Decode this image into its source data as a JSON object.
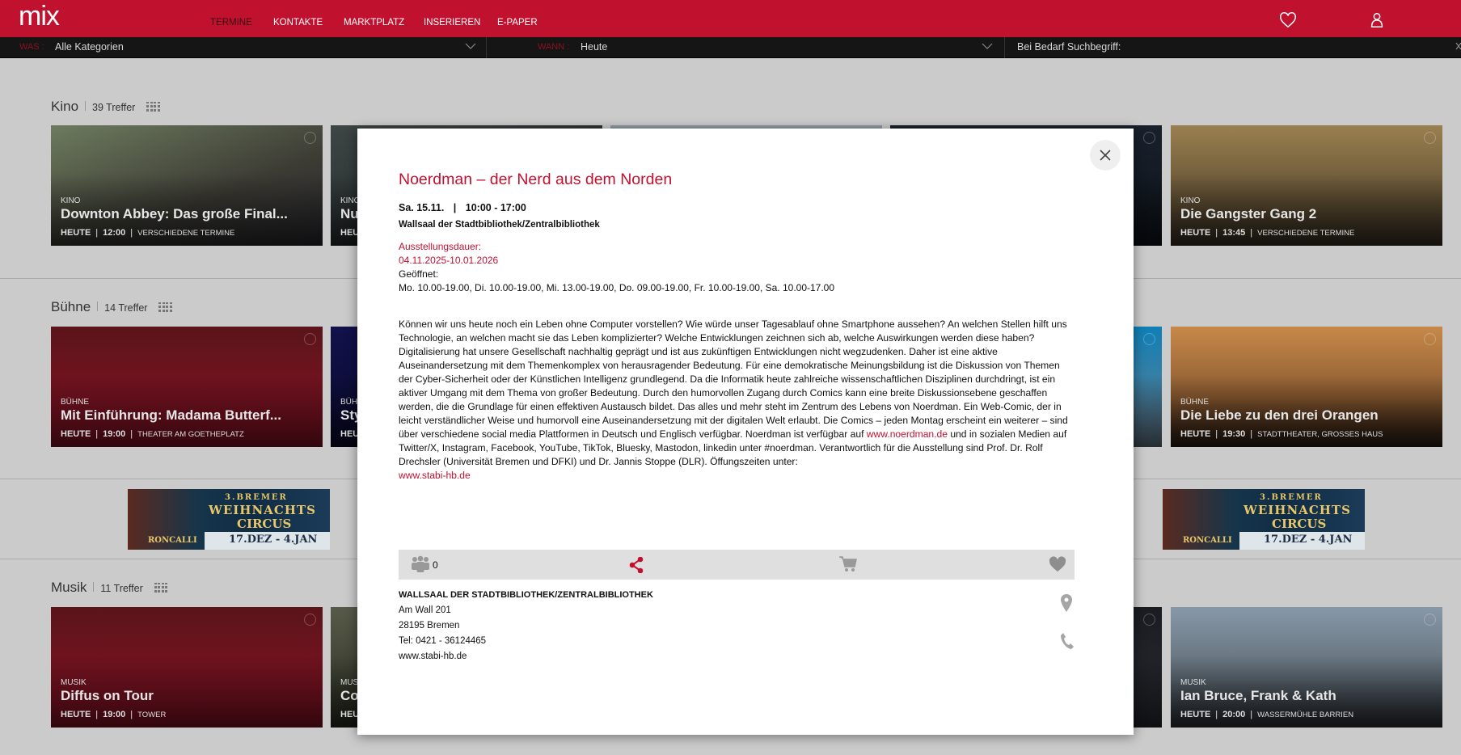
{
  "header": {
    "logo": "mix",
    "nav": [
      "TERMINE",
      "KONTAKTE",
      "MARKTPLATZ",
      "INSERIEREN",
      "E-PAPER"
    ],
    "active_nav": "TERMINE",
    "brand_color": "#c0112f"
  },
  "filter": {
    "was_label": "WAS :",
    "was_value": "Alle Kategorien",
    "wann_label": "WANN :",
    "wann_value": "Heute",
    "search_placeholder": "Bei Bedarf Suchbegriff:"
  },
  "sections": [
    {
      "title": "Kino",
      "count": "39 Treffer",
      "cards": [
        {
          "cat": "KINO",
          "title": "Downton Abbey: Das große Final...",
          "day": "HEUTE",
          "time": "12:00",
          "venue": "VERSCHIEDENE TERMINE"
        },
        {
          "cat": "KINO",
          "title": "Nu",
          "day": "HEUT"
        },
        {},
        {},
        {
          "cat": "KINO",
          "title": "Die Gangster Gang 2",
          "day": "HEUTE",
          "time": "13:45",
          "venue": "VERSCHIEDENE TERMINE"
        }
      ]
    },
    {
      "title": "Bühne",
      "count": "14 Treffer",
      "cards": [
        {
          "cat": "BÜHNE",
          "title": "Mit Einführung: Madama Butterf...",
          "day": "HEUTE",
          "time": "19:00",
          "venue": "THEATER AM GOETHEPLATZ"
        },
        {
          "cat": "BÜHN",
          "title": "Sty",
          "day": "HEU"
        },
        {},
        {},
        {
          "cat": "BÜHNE",
          "title": "Die Liebe zu den drei Orangen",
          "day": "HEUTE",
          "time": "19:30",
          "venue": "STADTTHEATER, GROSSES HAUS"
        }
      ]
    },
    {
      "title": "Musik",
      "count": "11 Treffer",
      "cards": [
        {
          "cat": "MUSIK",
          "title": "Diffus on Tour",
          "day": "HEUTE",
          "time": "19:00",
          "venue": "TOWER"
        },
        {
          "cat": "MUS",
          "title": "Co",
          "day": "HEU"
        },
        {},
        {},
        {
          "cat": "MUSIK",
          "title": "Ian Bruce, Frank & Kath",
          "day": "HEUTE",
          "time": "20:00",
          "venue": "WASSERMÜHLE BARRIEN"
        }
      ]
    }
  ],
  "banner": {
    "line1": "3.BREMER",
    "line2": "WEIHNACHTS",
    "line3": "CIRCUS",
    "dates": "17.DEZ - 4.JAN",
    "brand": "RONCALLI"
  },
  "modal": {
    "title": "Noerdman – der Nerd aus dem Norden",
    "date": "Sa. 15.11.",
    "time": "10:00 - 17:00",
    "venue": "Wallsaal der Stadtbibliothek/Zentralbibliothek",
    "duration_label": "Ausstellungsdauer:",
    "duration": "04.11.2025-10.01.2026",
    "open_label": "Geöffnet:",
    "hours": "Mo. 10.00-19.00, Di. 10.00-19.00, Mi. 13.00-19.00, Do. 09.00-19.00, Fr. 10.00-19.00, Sa. 10.00-17.00",
    "desc_1": "Können wir uns heute noch ein Leben ohne Computer vorstellen? Wie würde unser Tagesablauf ohne Smartphone aussehen? An welchen Stellen hilft uns Technologie, an welchen macht sie das Leben komplizierter? Welche Entwicklungen zeichnen sich ab, welche Auswirkungen werden diese haben? Digitalisierung hat unsere Gesellschaft nachhaltig geprägt und ist aus zukünftigen Entwicklungen nicht wegzudenken. Daher ist eine aktive Auseinandersetzung mit dem Themenkomplex von herausragender Bedeutung. Für eine demokratische Meinungsbildung ist die Diskussion von Themen der Cyber-Sicherheit oder der Künstlichen Intelligenz grundlegend. Da die Informatik heute zahlreiche wissenschaftlichen Disziplinen durchdringt, ist ein aktiver Umgang mit dem Thema von großer Bedeutung. Durch den humorvollen Zugang durch Comics kann eine breite Diskussionsebene geschaffen werden, die die Grundlage für einen effektiven Austausch bildet. Das alles und mehr steht im Zentrum des Lebens von Noerdman. Ein Web-Comic, der in leicht verständlicher Weise und humorvoll eine Auseinandersetzung mit der digitalen Welt erlaubt. Die Comics – jeden Montag erscheint ein weiterer – sind über verschiedene social media Plattformen in Deutsch und Englisch verfügbar. Noerdman ist verfügbar auf ",
    "desc_link1": "www.noerdman.de",
    "desc_2": " und in sozialen Medien auf Twitter/X, Instagram, Facebook, YouTube, TikTok, Bluesky, Mastodon, linkedin unter #noerdman. Verantwortlich für die Ausstellung sind Prof. Dr. Rolf Drechsler (Universität Bremen und DFKI) und Dr. Jannis Stoppe (DLR). Öffungszeiten unter: ",
    "desc_link2": "www.stabi-hb.de",
    "attendees": "0",
    "address": {
      "name": "WALLSAAL DER STADTBIBLIOTHEK/ZENTRALBIBLIOTHEK",
      "street": "Am Wall 201",
      "city": "28195 Bremen",
      "phone": "Tel: 0421 - 36124465",
      "web": "www.stabi-hb.de"
    }
  }
}
